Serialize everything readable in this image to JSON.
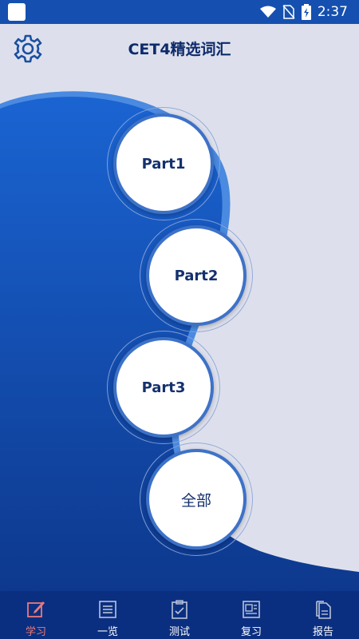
{
  "status_bar": {
    "time": "2:37"
  },
  "header": {
    "title": "CET4精选词汇"
  },
  "parts": [
    {
      "label": "Part1"
    },
    {
      "label": "Part2"
    },
    {
      "label": "Part3"
    },
    {
      "label": "全部"
    }
  ],
  "tabs": [
    {
      "label": "学习",
      "icon": "edit-icon",
      "active": true
    },
    {
      "label": "一览",
      "icon": "list-icon",
      "active": false
    },
    {
      "label": "测试",
      "icon": "clipboard-icon",
      "active": false
    },
    {
      "label": "复习",
      "icon": "word-doc-icon",
      "active": false
    },
    {
      "label": "报告",
      "icon": "documents-icon",
      "active": false
    }
  ],
  "colors": {
    "primary_blue": "#1550b0",
    "tab_bar": "#0b2f80",
    "active_tab": "#e9797a",
    "background": "#dde0ec",
    "title": "#0d2a6b"
  }
}
